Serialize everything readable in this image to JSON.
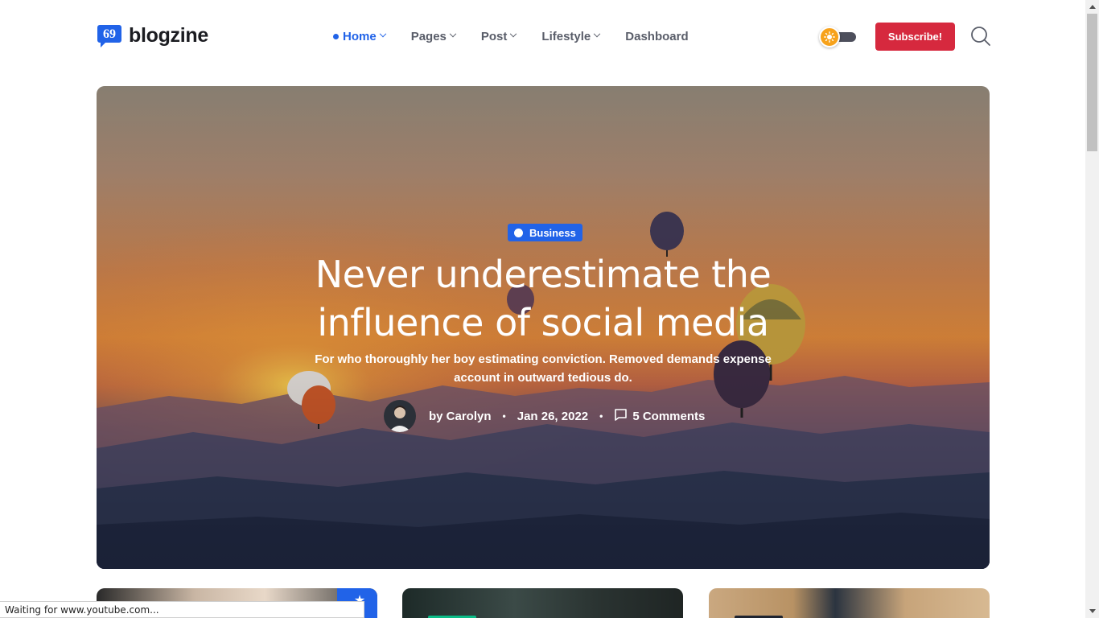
{
  "header": {
    "logo_text": "blogzine",
    "nav": [
      {
        "label": "Home",
        "active": true,
        "has_dropdown": true
      },
      {
        "label": "Pages",
        "active": false,
        "has_dropdown": true
      },
      {
        "label": "Post",
        "active": false,
        "has_dropdown": true
      },
      {
        "label": "Lifestyle",
        "active": false,
        "has_dropdown": true
      },
      {
        "label": "Dashboard",
        "active": false,
        "has_dropdown": false
      }
    ],
    "theme_toggle_icon": "sun-icon",
    "subscribe_label": "Subscribe!",
    "search_icon": "search-icon"
  },
  "hero": {
    "category": "Business",
    "title": "Never underestimate the influence of social media",
    "subtitle": "For who thoroughly her boy estimating conviction. Removed demands expense account in outward tedious do.",
    "author": "by Carolyn",
    "date": "Jan 26, 2022",
    "comments": "5 Comments"
  },
  "status_bar": {
    "text": "Waiting for www.youtube.com..."
  },
  "colors": {
    "primary": "#2163e8",
    "danger": "#d6293e",
    "success": "#0cbc87",
    "toggle_knob": "#f7a21b"
  }
}
